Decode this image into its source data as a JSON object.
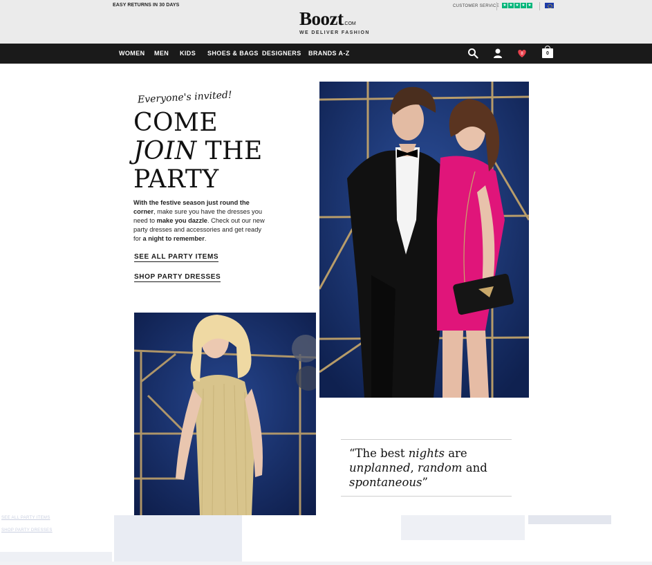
{
  "header": {
    "returns_text": "EASY RETURNS IN 30 DAYS",
    "logo_main": "Boozt",
    "logo_suffix": ".COM",
    "tagline": "WE DELIVER FASHION",
    "customer_service": "CUSTOMER SERVICE",
    "trustpilot_icon": "star-rating-icon",
    "region_icon": "eu-flag-icon"
  },
  "nav": {
    "items": [
      "WOMEN",
      "MEN",
      "KIDS",
      "SHOES & BAGS",
      "DESIGNERS",
      "BRANDS A-Z"
    ],
    "wishlist_count": "8",
    "cart_count": "0",
    "icons": [
      "search-icon",
      "user-icon",
      "heart-icon",
      "cart-icon"
    ]
  },
  "hero": {
    "script_line": "Everyone's invited!",
    "headline_1": "COME",
    "headline_2a": "JOIN",
    "headline_2b": " THE",
    "headline_3": "PARTY",
    "body": {
      "p1": "With the festive season just round the ",
      "p2": "corner",
      "p3": ", make sure you have the dresses you need to ",
      "p4": "make you dazzle",
      "p5": ".  Check out our new party dresses and accessories and get ready for ",
      "p6": "a night to remember",
      "p7": "."
    },
    "cta_1": "SEE ALL PARTY ITEMS",
    "cta_2": "SHOP PARTY DRESSES"
  },
  "quote": {
    "q1": "“The best ",
    "q2": "nights",
    "q3": " are ",
    "q4": "unplanned",
    "q5": ", ",
    "q6": "random",
    "q7": " and ",
    "q8": "spontaneous",
    "q9": "”"
  },
  "ghost": {
    "link_1": "SEE ALL PARTY ITEMS",
    "link_2": "SHOP PARTY DRESSES"
  },
  "colors": {
    "header_bg": "#ebebeb",
    "nav_bg": "#1a1a1a",
    "wall_blue": "#1e3a78",
    "gold": "#c9a86a",
    "dress_pink": "#e0157a",
    "heart_red": "#e8424d"
  }
}
